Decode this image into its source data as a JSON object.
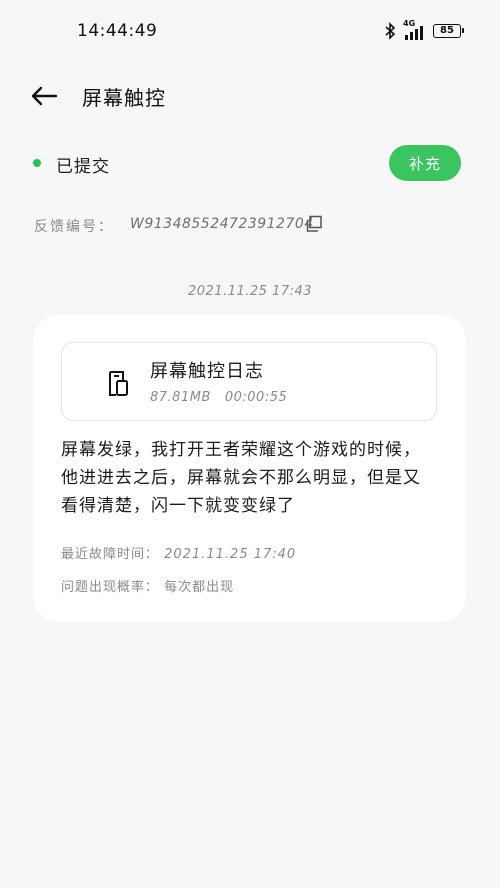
{
  "status_bar": {
    "time": "14:44:49",
    "network": "4G",
    "battery": "85"
  },
  "header": {
    "title": "屏幕触控"
  },
  "status": {
    "label": "已提交",
    "color": "#2fbf57",
    "supplement_label": "补充"
  },
  "feedback": {
    "label": "反馈编号：",
    "id": "W913485524723912704"
  },
  "timestamp": "2021.11.25 17:43",
  "card": {
    "attachment": {
      "title": "屏幕触控日志",
      "size": "87.81MB",
      "duration": "00:00:55"
    },
    "description": "屏幕发绿，我打开王者荣耀这个游戏的时候，他进进去之后，屏幕就会不那么明显，但是又看得清楚，闪一下就变变绿了",
    "last_fault_label": "最近故障时间：",
    "last_fault_time": "2021.11.25 17:40",
    "frequency_label": "问题出现概率：",
    "frequency_value": "每次都出现"
  },
  "accent_color": "#3cc460"
}
